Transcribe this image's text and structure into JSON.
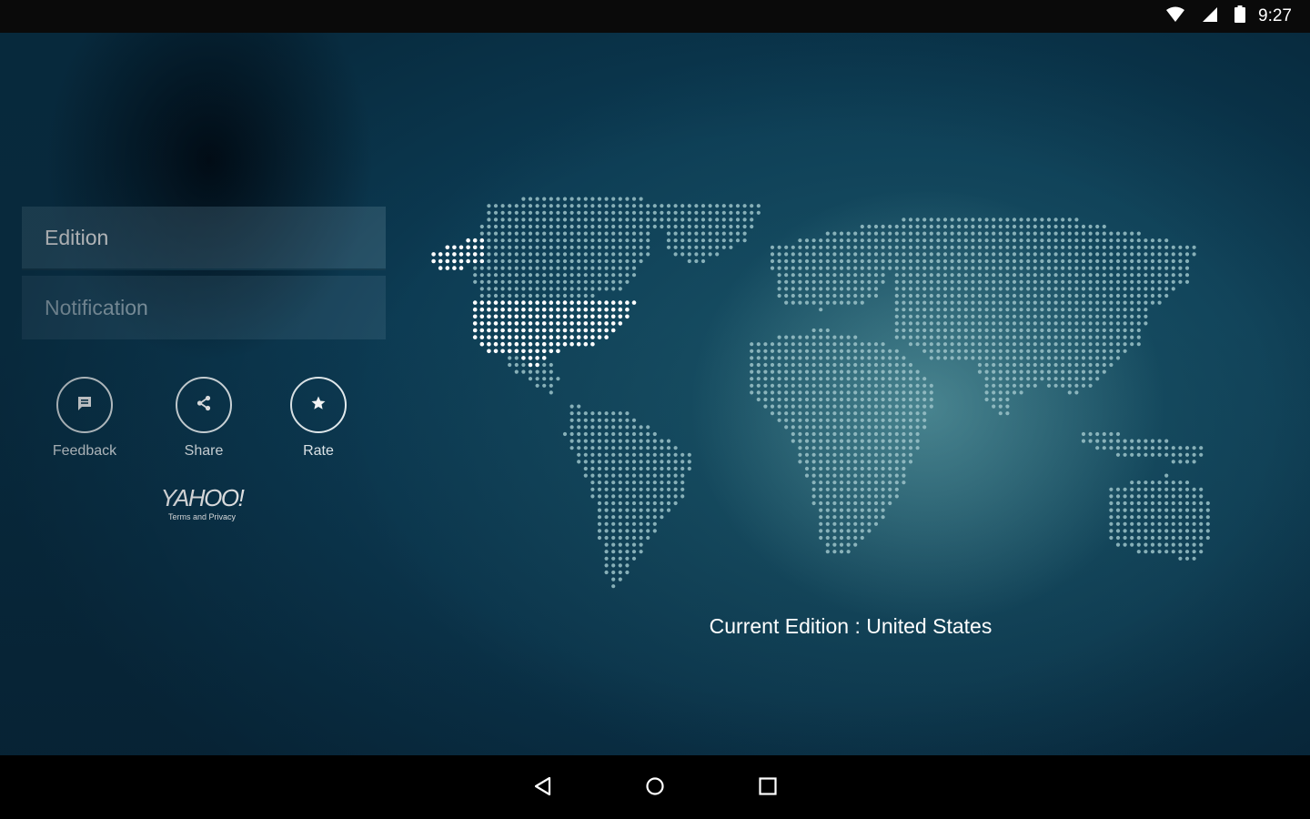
{
  "status_bar": {
    "time": "9:27",
    "icons": [
      "wifi-icon",
      "cell-signal-icon",
      "battery-icon"
    ]
  },
  "menu": {
    "items": [
      {
        "label": "Edition",
        "selected": true
      },
      {
        "label": "Notification",
        "selected": false
      }
    ]
  },
  "actions": [
    {
      "label": "Feedback",
      "icon": "chat-bubble-icon"
    },
    {
      "label": "Share",
      "icon": "share-icon"
    },
    {
      "label": "Rate",
      "icon": "star-icon"
    }
  ],
  "branding": {
    "logo": "YAHOO!",
    "terms_link": "Terms and Privacy"
  },
  "edition": {
    "current_text": "Current Edition : United States",
    "highlighted_region": "United States"
  },
  "nav_bar": {
    "buttons": [
      "back-icon",
      "home-icon",
      "recents-icon"
    ]
  },
  "colors": {
    "background": "#0c3a52",
    "map_dots": "#9cc3c9",
    "highlight_dots": "#ffffff",
    "text": "#ffffff"
  }
}
